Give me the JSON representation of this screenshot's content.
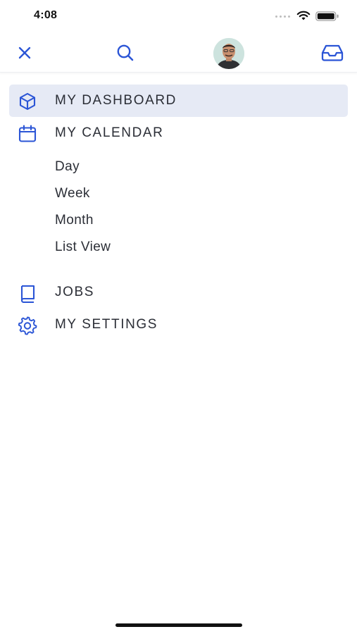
{
  "status_bar": {
    "time": "4:08"
  },
  "top_nav": {
    "icons": [
      "close-icon",
      "search-icon",
      "avatar",
      "inbox-icon"
    ]
  },
  "menu": {
    "dashboard": {
      "label": "MY DASHBOARD",
      "icon": "cube-icon",
      "active": true
    },
    "calendar": {
      "label": "MY CALENDAR",
      "icon": "calendar-icon",
      "sub_items": [
        "Day",
        "Week",
        "Month",
        "List View"
      ]
    },
    "jobs": {
      "label": "JOBS",
      "icon": "book-icon"
    },
    "settings": {
      "label": "MY SETTINGS",
      "icon": "gear-icon"
    }
  },
  "colors": {
    "accent": "#2b55d6",
    "active_bg": "#e6eaf5",
    "text": "#2b2e36"
  }
}
